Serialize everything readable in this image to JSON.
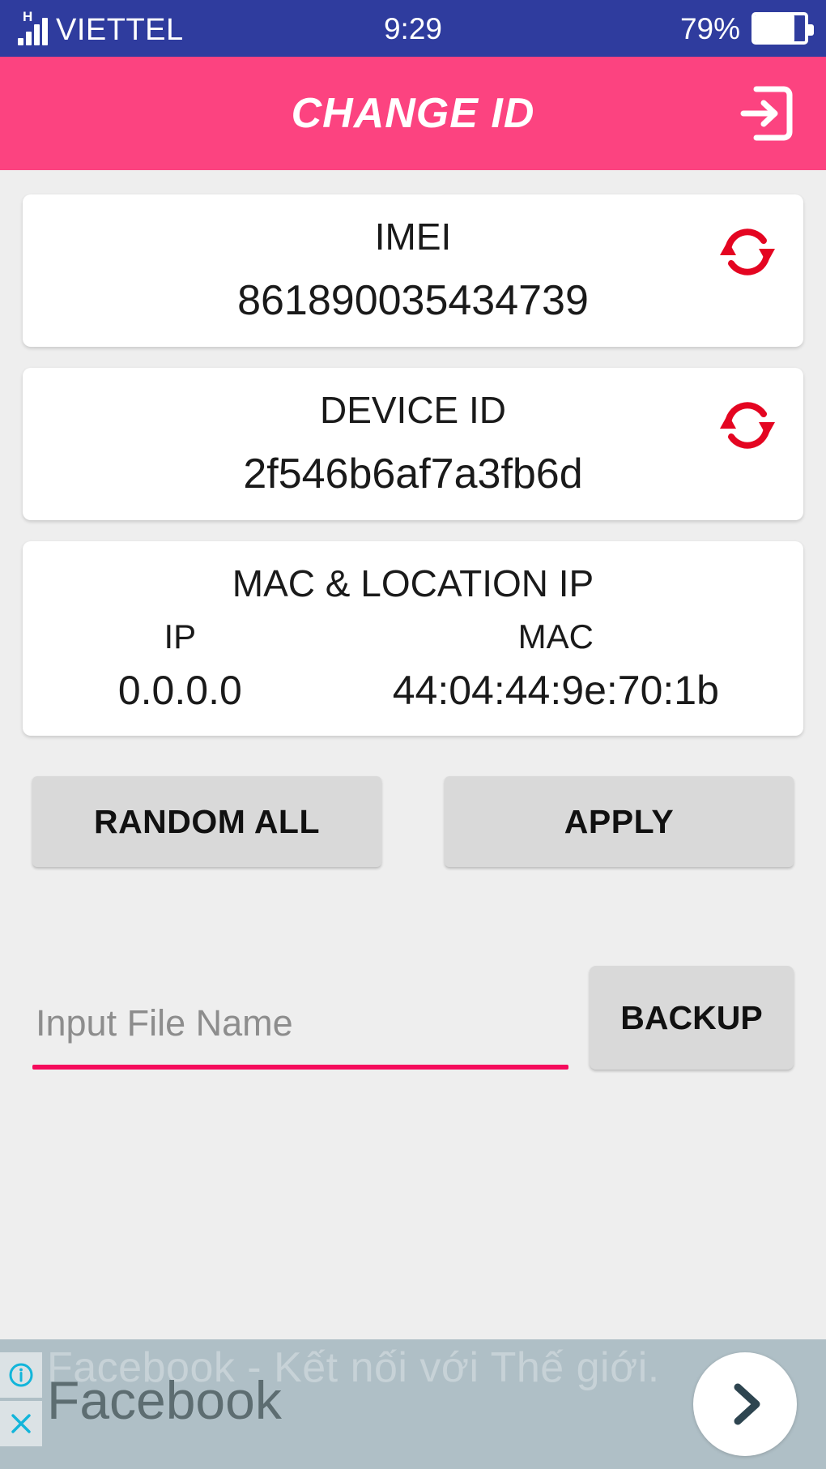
{
  "status_bar": {
    "network_type": "H",
    "carrier": "VIETTEL",
    "time": "9:29",
    "battery_percent": "79%",
    "battery_level": 79,
    "bg_color": "#2f3c9e"
  },
  "app_bar": {
    "title": "CHANGE ID",
    "action_icon": "exit-to-app-icon",
    "bg_color": "#fc4380"
  },
  "cards": {
    "imei": {
      "title": "IMEI",
      "value": "861890035434739",
      "refresh_icon": "sync-refresh-icon"
    },
    "device_id": {
      "title": "DEVICE ID",
      "value": "2f546b6af7a3fb6d",
      "refresh_icon": "sync-refresh-icon"
    },
    "mac_location": {
      "title": "MAC & LOCATION IP",
      "ip_label": "IP",
      "ip_value": "0.0.0.0",
      "mac_label": "MAC",
      "mac_value": "44:04:44:9e:70:1b"
    }
  },
  "actions": {
    "random_all_label": "RANDOM ALL",
    "apply_label": "APPLY"
  },
  "backup": {
    "input_placeholder": "Input File Name",
    "input_value": "",
    "button_label": "BACKUP",
    "underline_color": "#f50a5c"
  },
  "ad": {
    "ghost_text": "Facebook - Kết nối với Thế giới.",
    "brand": "Facebook",
    "info_icon": "info-circle-icon",
    "close_icon": "close-x-icon",
    "cta_icon": "chevron-right-icon",
    "bg_color": "#afbfc6"
  }
}
